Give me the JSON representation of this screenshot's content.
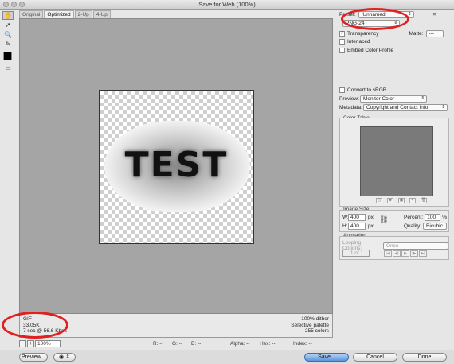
{
  "window": {
    "title": "Save for Web (100%)"
  },
  "tabs": [
    "Original",
    "Optimized",
    "2-Up",
    "4-Up"
  ],
  "active_tab": 1,
  "image": {
    "text": "TEST"
  },
  "info_left": {
    "format": "GIF",
    "size": "33.05K",
    "time": "7 sec @ 56.6 Kbps"
  },
  "info_right": {
    "dither": "100% dither",
    "palette": "Selective palette",
    "colors": "255 colors"
  },
  "status": {
    "zoom": "100%",
    "r": "R: --",
    "g": "G: --",
    "b": "B: --",
    "alpha": "Alpha: --",
    "hex": "Hex: --",
    "index": "Index: --"
  },
  "buttons": {
    "preview": "Preview...",
    "save": "Save...",
    "cancel": "Cancel",
    "done": "Done"
  },
  "settings": {
    "preset_label": "Preset:",
    "preset_value": "[Unnamed]",
    "format_value": "PNG-24",
    "transparency_label": "Transparency",
    "transparency_checked": true,
    "matte_label": "Matte:",
    "matte_value": "---",
    "interlaced_label": "Interlaced",
    "embed_label": "Embed Color Profile",
    "convert_label": "Convert to sRGB",
    "preview_label": "Preview:",
    "preview_value": "Monitor Color",
    "metadata_label": "Metadata:",
    "metadata_value": "Copyright and Contact Info"
  },
  "color_table": {
    "title": "Color Table"
  },
  "image_size": {
    "title": "Image Size",
    "w_label": "W:",
    "w_value": "400",
    "h_label": "H:",
    "h_value": "400",
    "unit": "px",
    "percent_label": "Percent:",
    "percent_value": "100",
    "percent_unit": "%",
    "quality_label": "Quality:",
    "quality_value": "Bicubic"
  },
  "animation": {
    "title": "Animation",
    "looping_label": "Looping Options:",
    "looping_value": "Once",
    "frame": "1 of 1"
  },
  "accent_colors": {
    "annotation_red": "#e02020",
    "save_blue": "#5b95dd"
  }
}
